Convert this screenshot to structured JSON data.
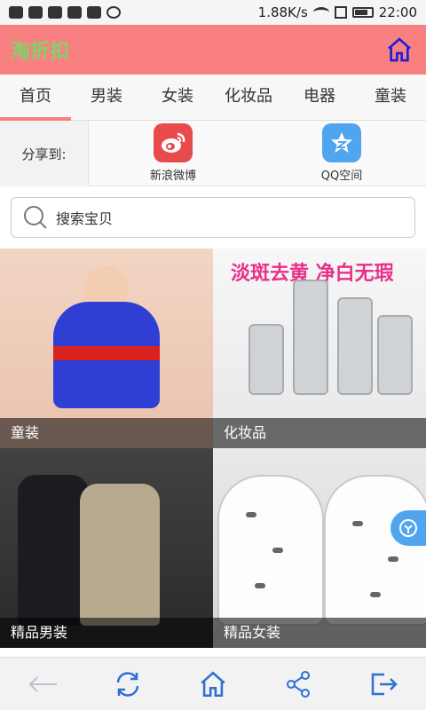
{
  "status": {
    "speed": "1.88K/s",
    "time": "22:00"
  },
  "header": {
    "title": "淘折扣"
  },
  "tabs": [
    {
      "label": "首页",
      "active": true
    },
    {
      "label": "男装",
      "active": false
    },
    {
      "label": "女装",
      "active": false
    },
    {
      "label": "化妆品",
      "active": false
    },
    {
      "label": "电器",
      "active": false
    },
    {
      "label": "童装",
      "active": false
    }
  ],
  "share": {
    "label": "分享到:",
    "items": [
      {
        "label": "新浪微博",
        "icon": "weibo-icon"
      },
      {
        "label": "QQ空间",
        "icon": "qzone-icon"
      }
    ]
  },
  "search": {
    "placeholder": "搜索宝贝"
  },
  "tiles": [
    {
      "label": "童装"
    },
    {
      "label": "化妆品",
      "headline": "淡斑去黄 净白无瑕"
    },
    {
      "label": "精品男装"
    },
    {
      "label": "精品女装"
    }
  ],
  "colors": {
    "header_bg": "#f98080",
    "title": "#7fd36b",
    "accent_blue": "#2f6fd6"
  }
}
